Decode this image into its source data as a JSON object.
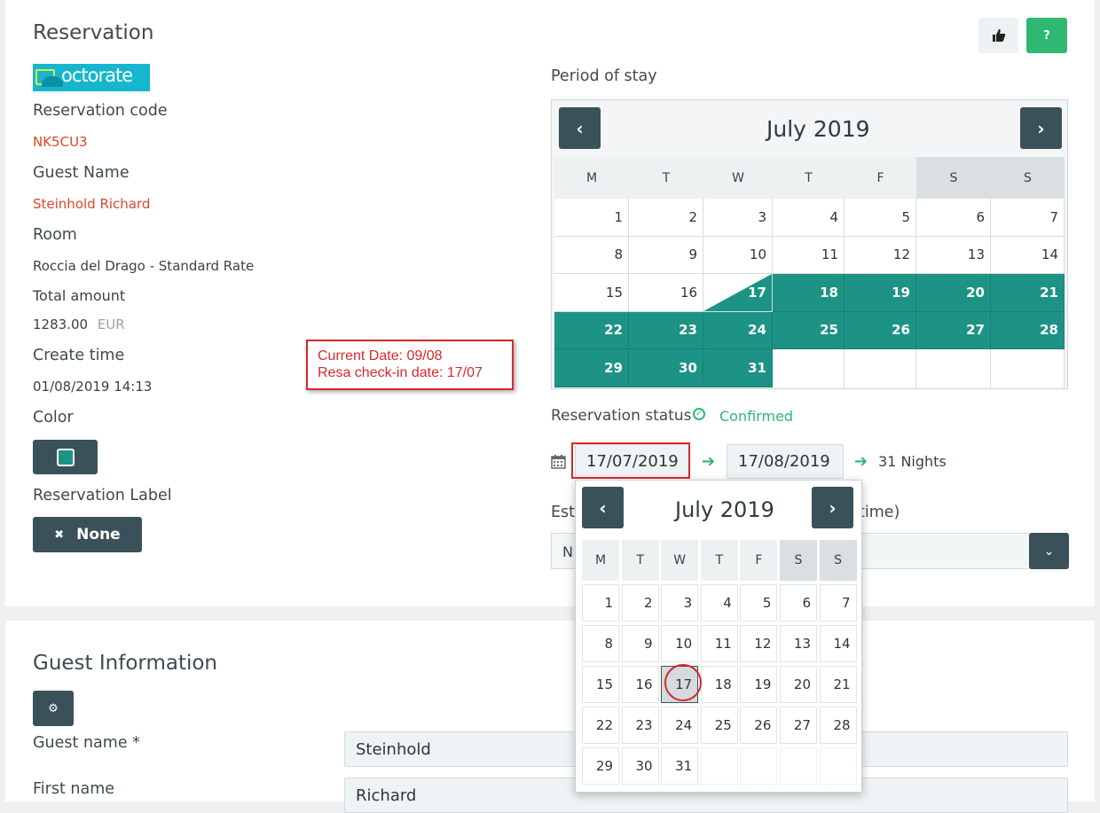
{
  "reservation": {
    "title": "Reservation",
    "logo_text": "octorate",
    "code_label": "Reservation code",
    "code_value": "NK5CU3",
    "guest_label": "Guest Name",
    "guest_value": "Steinhold Richard",
    "room_label": "Room",
    "room_value": "Roccia del Drago - Standard Rate",
    "total_label": "Total amount",
    "total_value": "1283.00",
    "total_currency": "EUR",
    "create_label": "Create time",
    "create_value": "01/08/2019 14:13",
    "color_label": "Color",
    "color_swatch": "#1d9385",
    "label_label": "Reservation Label",
    "label_button": "None"
  },
  "toolbar": {
    "like_icon": "thumbs-up-icon",
    "help_label": "?"
  },
  "annotation": {
    "line1": "Current Date: 09/08",
    "line2": "Resa check-in date: 17/07"
  },
  "period": {
    "label": "Period of stay",
    "month_title": "July 2019",
    "dow": [
      "M",
      "T",
      "W",
      "T",
      "F",
      "S",
      "S"
    ],
    "weeks": [
      [
        "1",
        "2",
        "3",
        "4",
        "5",
        "6",
        "7"
      ],
      [
        "8",
        "9",
        "10",
        "11",
        "12",
        "13",
        "14"
      ],
      [
        "15",
        "16",
        "17",
        "18",
        "19",
        "20",
        "21"
      ],
      [
        "22",
        "23",
        "24",
        "25",
        "26",
        "27",
        "28"
      ],
      [
        "29",
        "30",
        "31",
        "",
        "",
        "",
        ""
      ]
    ]
  },
  "status": {
    "label": "Reservation status",
    "value": "Confirmed"
  },
  "dates": {
    "checkin": "17/07/2019",
    "checkout": "17/08/2019",
    "nights": "31 Nights"
  },
  "estimated": {
    "label_start": "Est",
    "label_end": "time)",
    "select_value": "N"
  },
  "popup": {
    "month_title": "July 2019",
    "dow": [
      "M",
      "T",
      "W",
      "T",
      "F",
      "S",
      "S"
    ],
    "weeks": [
      [
        "",
        "",
        "",
        "",
        "",
        "",
        ""
      ],
      [
        "1",
        "2",
        "3",
        "4",
        "5",
        "6",
        "7"
      ],
      [
        "8",
        "9",
        "10",
        "11",
        "12",
        "13",
        "14"
      ],
      [
        "15",
        "16",
        "17",
        "18",
        "19",
        "20",
        "21"
      ],
      [
        "22",
        "23",
        "24",
        "25",
        "26",
        "27",
        "28"
      ],
      [
        "29",
        "30",
        "31",
        "",
        "",
        "",
        ""
      ]
    ]
  },
  "guest_info": {
    "title": "Guest Information",
    "guest_name_label": "Guest name",
    "required_mark": "*",
    "guest_name_value": "Steinhold",
    "first_name_label": "First name",
    "first_name_value": "Richard"
  },
  "colors": {
    "teal": "#1d9385",
    "dark": "#3b5159",
    "green": "#2eb872",
    "red_text": "#e0452a",
    "annotation": "#d9282c"
  }
}
